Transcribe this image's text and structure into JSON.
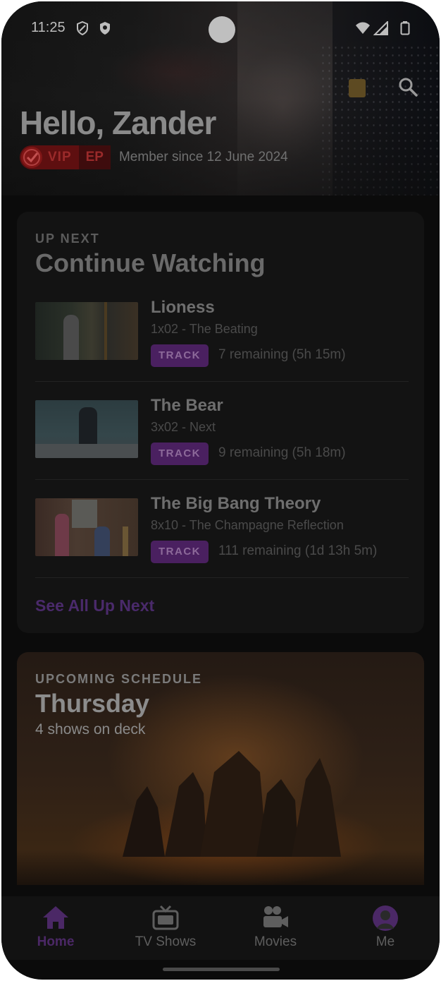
{
  "status_bar": {
    "time": "11:25"
  },
  "header": {
    "greeting": "Hello, Zander",
    "badge_vip": "VIP",
    "badge_ep": "EP",
    "member_since": "Member since 12 June 2024"
  },
  "continue_watching": {
    "overline": "UP NEXT",
    "title": "Continue Watching",
    "items": [
      {
        "show": "Lioness",
        "episode": "1x02 - The Beating",
        "action": "TRACK",
        "remaining": "7 remaining (5h 15m)"
      },
      {
        "show": "The Bear",
        "episode": "3x02 - Next",
        "action": "TRACK",
        "remaining": "9 remaining (5h 18m)"
      },
      {
        "show": "The Big Bang Theory",
        "episode": "8x10 - The Champagne Reflection",
        "action": "TRACK",
        "remaining": "111 remaining (1d 13h 5m)"
      }
    ],
    "see_all": "See All Up Next"
  },
  "schedule": {
    "overline": "UPCOMING SCHEDULE",
    "day": "Thursday",
    "count": "4 shows on deck"
  },
  "nav": {
    "items": [
      {
        "label": "Home",
        "icon": "home-icon"
      },
      {
        "label": "TV Shows",
        "icon": "tv-icon"
      },
      {
        "label": "Movies",
        "icon": "movie-camera-icon"
      },
      {
        "label": "Me",
        "icon": "avatar"
      }
    ]
  },
  "colors": {
    "accent": "#4b2866",
    "vip_red": "#5e0f10",
    "background": "#0b0b0b"
  }
}
